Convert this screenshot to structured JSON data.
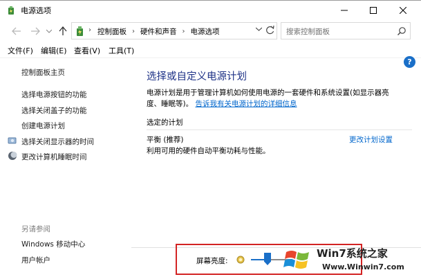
{
  "window": {
    "title": "电源选项"
  },
  "nav": {
    "crumb_lead": "›",
    "breadcrumb": [
      "控制面板",
      "硬件和声音",
      "电源选项"
    ],
    "search_placeholder": "搜索控制面板"
  },
  "menu": [
    "文件(F)",
    "编辑(E)",
    "查看(V)",
    "工具(T)"
  ],
  "sidebar": {
    "home": "控制面板主页",
    "links": [
      "选择电源按钮的功能",
      "选择关闭盖子的功能",
      "创建电源计划",
      "选择关闭显示器的时间",
      "更改计算机睡眠时间"
    ],
    "see_also_heading": "另请参阅",
    "see_also": [
      "Windows 移动中心",
      "用户帐户"
    ]
  },
  "main": {
    "title": "选择或自定义电源计划",
    "desc_line1": "电源计划是用于管理计算机如何使用电源的一套硬件和系统设置(如显示器亮",
    "desc_line2_prefix": "度、睡眠等)。",
    "desc_link": "告诉我有关电源计划的详细信息",
    "selected_heading": "选定的计划",
    "plan_name": "平衡 (推荐)",
    "plan_desc": "利用可用的硬件自动平衡功耗与性能。",
    "change_plan": "更改计划设置"
  },
  "brightness": {
    "label": "屏幕亮度:",
    "level": 0.4
  },
  "watermark": {
    "brand": "Win7系统之家",
    "url": "Www.Winwin7.com"
  },
  "colors": {
    "title_blue": "#1e3287",
    "link_blue": "#0066cc",
    "accent": "#1a6fc8",
    "highlight_red": "#d32323"
  }
}
